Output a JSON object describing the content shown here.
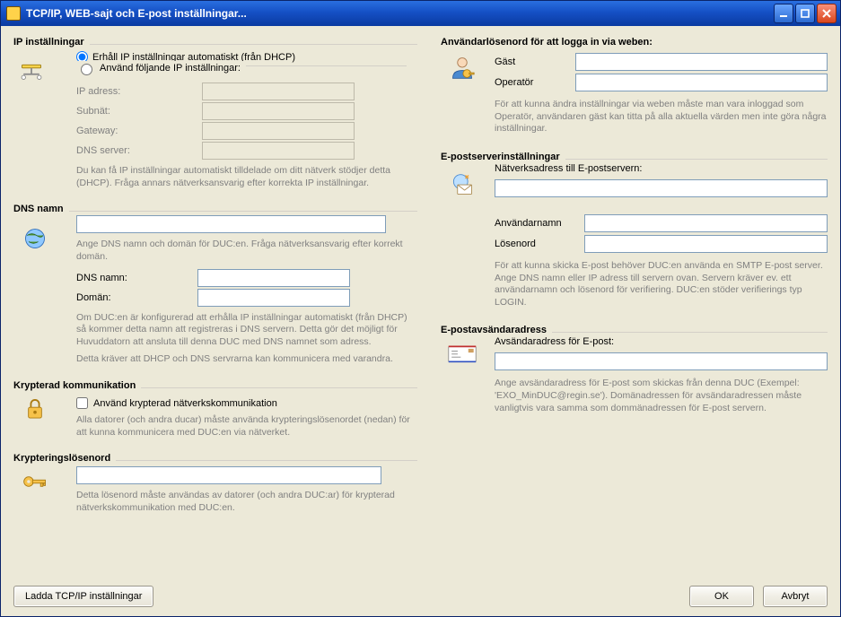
{
  "window": {
    "title": "TCP/IP, WEB-sajt och E-post inställningar..."
  },
  "ip": {
    "group_title": "IP inställningar",
    "radio_auto": "Erhåll IP inställningar automatiskt (från DHCP)",
    "radio_manual": "Använd följande IP inställningar:",
    "ip_address": "IP adress:",
    "subnet": "Subnät:",
    "gateway": "Gateway:",
    "dns_server": "DNS server:",
    "hint": "Du kan få IP inställningar automatiskt tilldelade om ditt nätverk stödjer detta (DHCP). Fråga annars nätverksansvarig efter korrekta IP inställningar."
  },
  "dns": {
    "group_title": "DNS namn",
    "hint1": "Ange DNS namn och domän för DUC:en. Fråga nätverksansvarig efter korrekt domän.",
    "dns_name": "DNS namn:",
    "domain": "Domän:",
    "hint2": "Om DUC:en är konfigurerad att erhålla IP inställningar automatiskt (från DHCP) så kommer detta namn att registreras i DNS servern. Detta gör det möjligt för Huvuddatorn att ansluta till denna DUC med DNS namnet som adress.",
    "hint3": "Detta kräver att DHCP och DNS servrarna kan kommunicera med varandra."
  },
  "encrypt": {
    "group_title": "Krypterad kommunikation",
    "checkbox": "Använd krypterad nätverkskommunikation",
    "hint": "Alla datorer (och andra ducar) måste använda krypteringslösenordet (nedan) för att kunna kommunicera med DUC:en via nätverket."
  },
  "encpass": {
    "group_title": "Krypteringslösenord",
    "hint": "Detta lösenord måste användas av datorer (och andra DUC:ar) för krypterad nätverkskommunikation med DUC:en."
  },
  "userpw": {
    "group_title": "Användarlösenord för att logga in via weben:",
    "guest": "Gäst",
    "operator": "Operatör",
    "hint": "För att kunna ändra inställningar via weben måste man vara inloggad som Operatör, användaren gäst kan titta på alla aktuella värden men inte göra några inställningar."
  },
  "smtp": {
    "group_title": "E-postserverinställningar",
    "server_label": "Nätverksadress till E-postservern:",
    "user_label": "Användarnamn",
    "pass_label": "Lösenord",
    "hint": "För att kunna skicka E-post behöver DUC:en använda en SMTP E-post server. Ange DNS namn eller IP adress till servern ovan. Servern kräver ev. ett användarnamn och lösenord för verifiering. DUC:en stöder verifierings typ LOGIN."
  },
  "sender": {
    "group_title": "E-postavsändaradress",
    "label": "Avsändaradress för E-post:",
    "hint": "Ange avsändaradress för E-post som skickas från denna DUC (Exempel: 'EXO_MinDUC@regin.se'). Domänadressen för avsändaradressen måste vanligtvis vara samma som dommänadressen för E-post servern."
  },
  "buttons": {
    "load": "Ladda TCP/IP inställningar",
    "ok": "OK",
    "cancel": "Avbryt"
  }
}
